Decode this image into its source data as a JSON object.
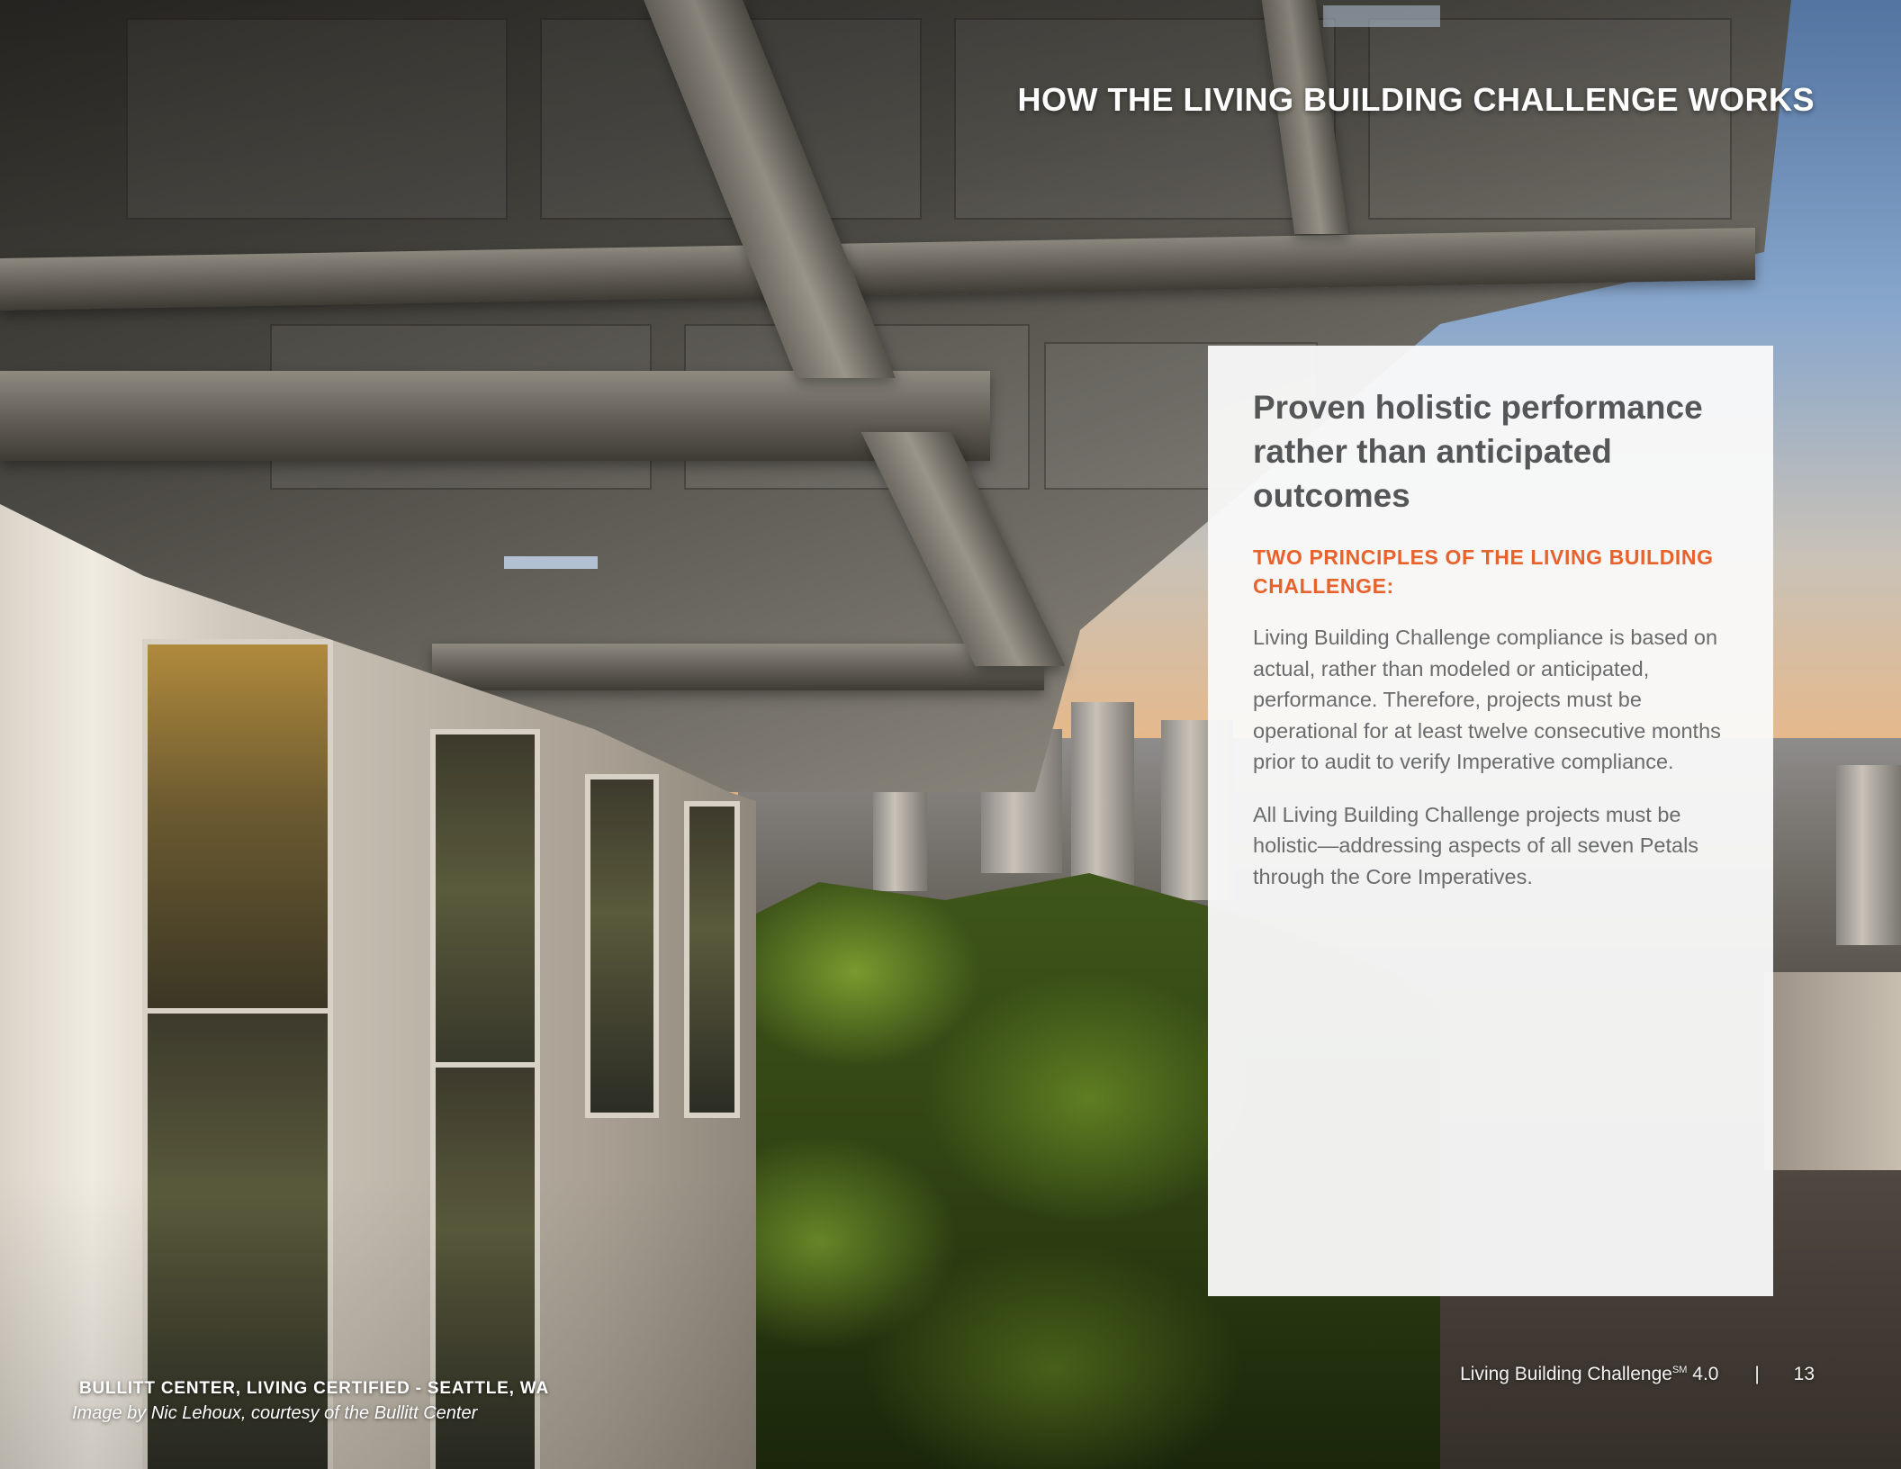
{
  "header": {
    "title": "HOW THE LIVING BUILDING CHALLENGE WORKS"
  },
  "card": {
    "heading": "Proven holistic performance rather than anticipated outcomes",
    "subheading": "TWO PRINCIPLES OF THE LIVING BUILDING CHALLENGE:",
    "paragraphs": [
      "Living Building Challenge compliance is based on actual, rather than modeled or anticipated, performance. Therefore, projects must be operational for at least twelve consecutive months prior to audit to verify Imperative compliance.",
      "All Living Building Challenge projects must be holistic—addressing aspects of all seven Petals through the Core Imperatives."
    ]
  },
  "caption": {
    "title": "BULLITT CENTER, LIVING CERTIFIED - SEATTLE, WA",
    "credit": "Image by Nic Lehoux, courtesy of the Bullitt Center"
  },
  "footer": {
    "doc_name": "Living Building Challenge",
    "superscript": "SM",
    "version": "4.0",
    "separator": "|",
    "page_number": "13"
  },
  "colors": {
    "accent": "#e8622c",
    "heading": "#555657",
    "body_text": "#6a6b6c",
    "card_background": "#fafafa"
  }
}
